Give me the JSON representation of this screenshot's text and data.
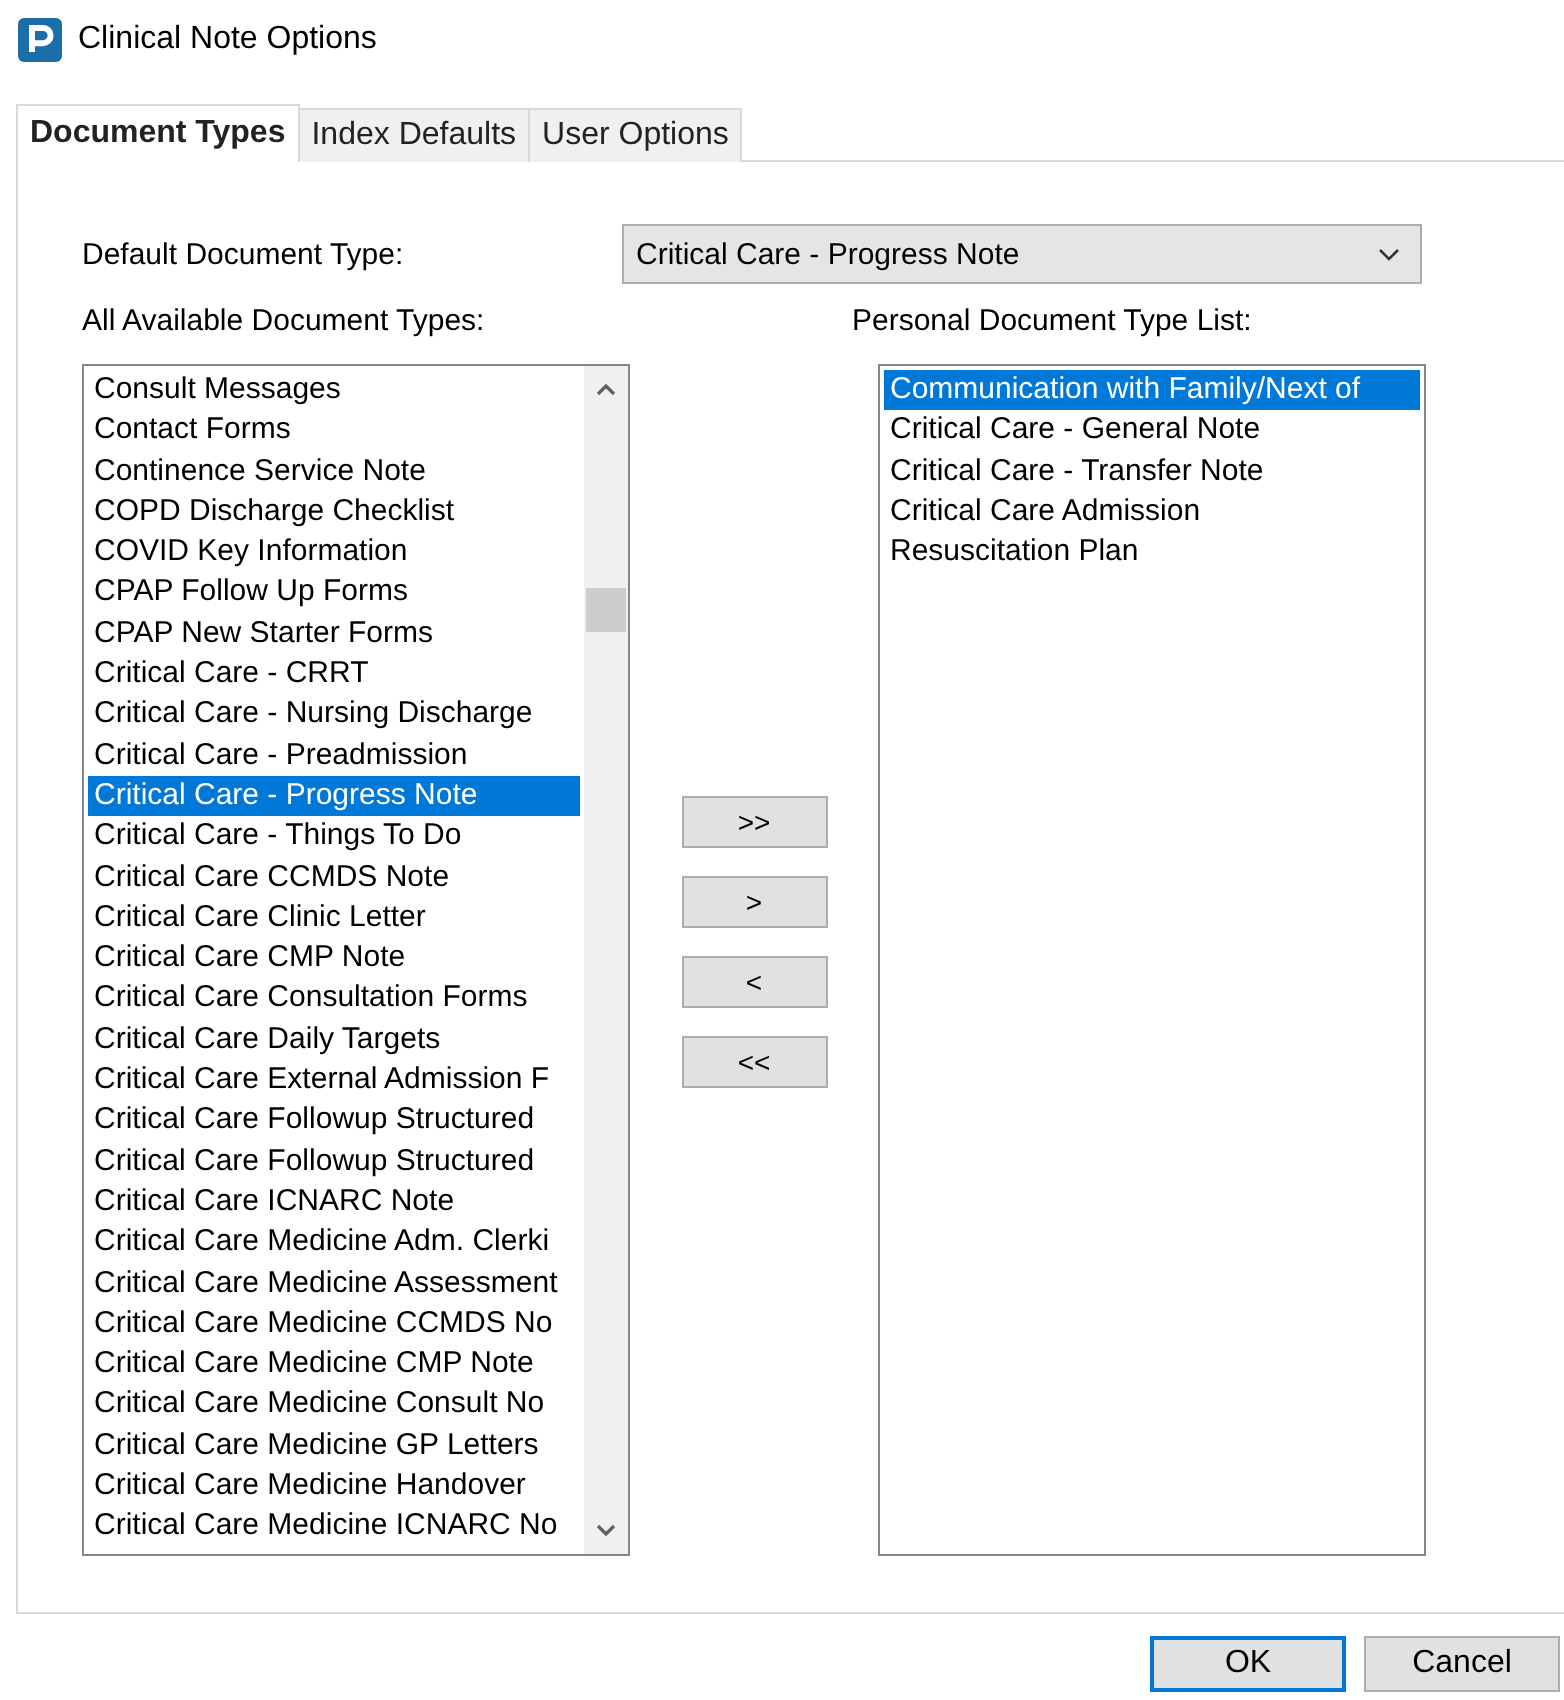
{
  "window": {
    "title": "Clinical Note Options"
  },
  "tabs": [
    {
      "label": "Document Types",
      "selected": true
    },
    {
      "label": "Index Defaults",
      "selected": false
    },
    {
      "label": "User Options",
      "selected": false
    }
  ],
  "default_document_type": {
    "label": "Default Document Type:",
    "value": "Critical Care - Progress Note"
  },
  "available_list": {
    "label": "All Available Document Types:",
    "items": [
      {
        "text": "Consult Messages",
        "selected": false
      },
      {
        "text": "Contact Forms",
        "selected": false
      },
      {
        "text": "Continence Service Note",
        "selected": false
      },
      {
        "text": "COPD Discharge Checklist",
        "selected": false
      },
      {
        "text": "COVID Key Information",
        "selected": false
      },
      {
        "text": "CPAP Follow Up Forms",
        "selected": false
      },
      {
        "text": "CPAP New Starter Forms",
        "selected": false
      },
      {
        "text": "Critical Care - CRRT",
        "selected": false
      },
      {
        "text": "Critical Care - Nursing Discharge",
        "selected": false
      },
      {
        "text": "Critical Care - Preadmission",
        "selected": false
      },
      {
        "text": "Critical Care - Progress Note",
        "selected": true
      },
      {
        "text": "Critical Care - Things To Do",
        "selected": false
      },
      {
        "text": "Critical Care CCMDS Note",
        "selected": false
      },
      {
        "text": "Critical Care Clinic Letter",
        "selected": false
      },
      {
        "text": "Critical Care CMP Note",
        "selected": false
      },
      {
        "text": "Critical Care Consultation Forms",
        "selected": false
      },
      {
        "text": "Critical Care Daily Targets",
        "selected": false
      },
      {
        "text": "Critical Care External Admission F",
        "selected": false
      },
      {
        "text": "Critical Care Followup Structured",
        "selected": false
      },
      {
        "text": "Critical Care Followup Structured",
        "selected": false
      },
      {
        "text": "Critical Care ICNARC Note",
        "selected": false
      },
      {
        "text": "Critical Care Medicine Adm. Clerki",
        "selected": false
      },
      {
        "text": "Critical Care Medicine Assessment",
        "selected": false
      },
      {
        "text": "Critical Care Medicine CCMDS No",
        "selected": false
      },
      {
        "text": "Critical Care Medicine CMP Note",
        "selected": false
      },
      {
        "text": "Critical Care Medicine Consult No",
        "selected": false
      },
      {
        "text": "Critical Care Medicine GP Letters",
        "selected": false
      },
      {
        "text": "Critical Care Medicine Handover",
        "selected": false
      },
      {
        "text": "Critical Care Medicine ICNARC No",
        "selected": false
      }
    ]
  },
  "transfer_buttons": [
    ">>",
    ">",
    "<",
    "<<"
  ],
  "personal_list": {
    "label": "Personal Document Type List:",
    "items": [
      {
        "text": "Communication with Family/Next of",
        "selected": true
      },
      {
        "text": "Critical Care - General Note",
        "selected": false
      },
      {
        "text": "Critical Care - Transfer Note",
        "selected": false
      },
      {
        "text": "Critical Care Admission",
        "selected": false
      },
      {
        "text": "Resuscitation Plan",
        "selected": false
      }
    ]
  },
  "buttons": [
    {
      "label": "OK",
      "default": true
    },
    {
      "label": "Cancel",
      "default": false
    }
  ]
}
